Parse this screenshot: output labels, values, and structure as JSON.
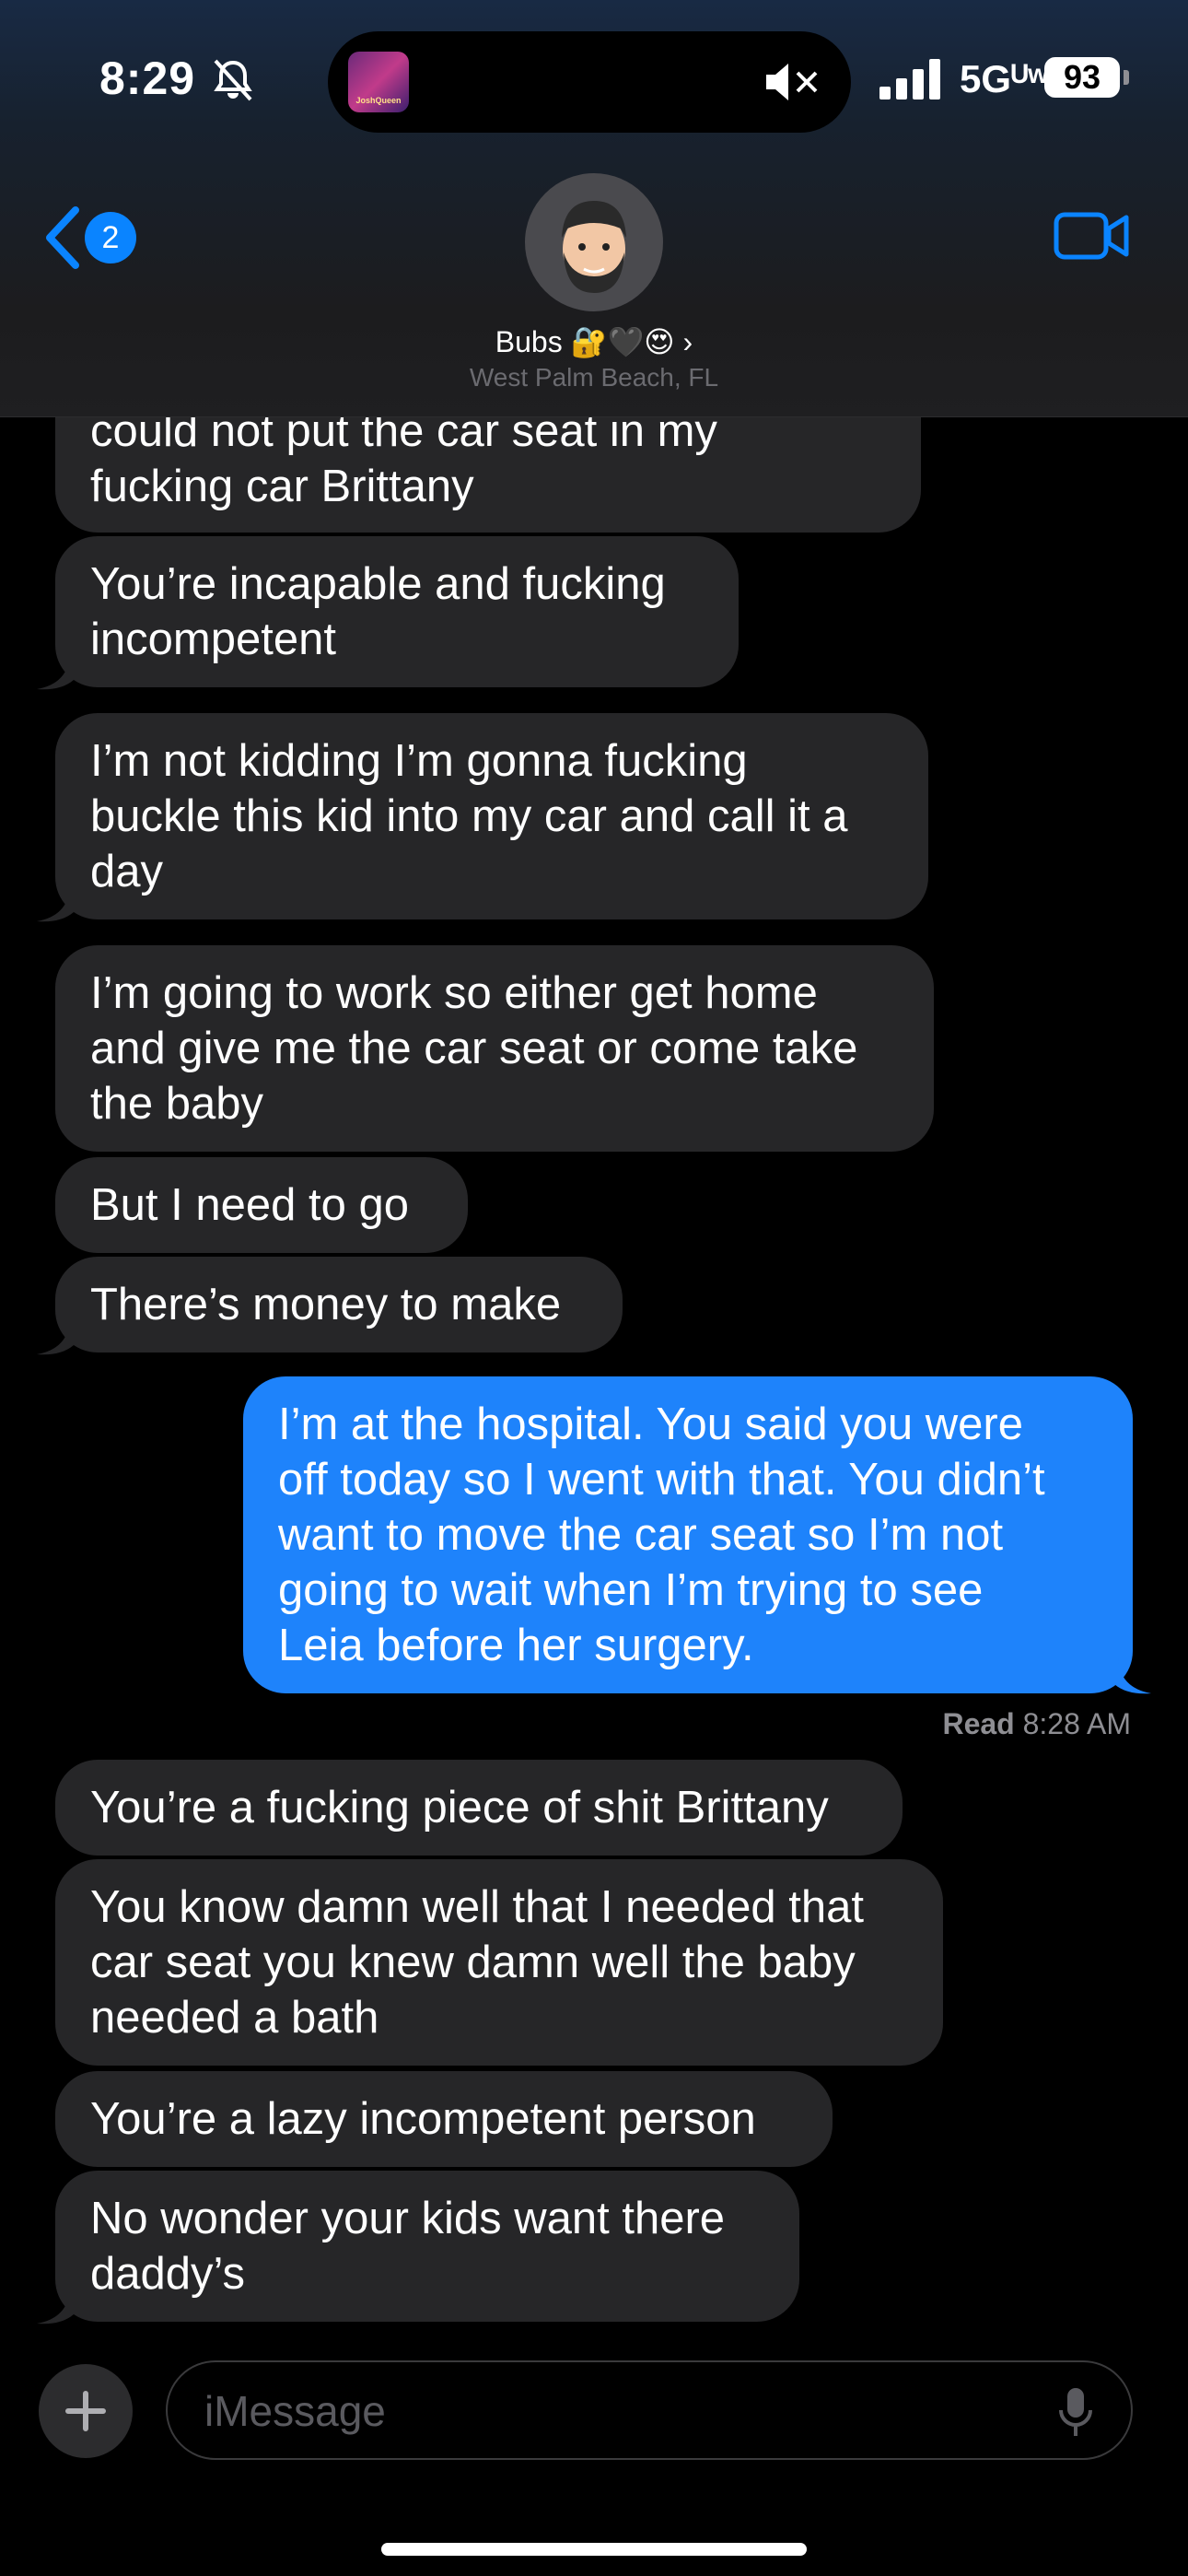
{
  "status_bar": {
    "time": "8:29",
    "network": "5Gᵁʷ",
    "battery": "93",
    "island_thumb_text": "JoshQueen"
  },
  "header": {
    "back_count": "2",
    "contact_name": "Bubs 🔐🖤😍 ›",
    "contact_location": "West Palm Beach, FL"
  },
  "messages": [
    {
      "from": "them",
      "text": "could not put the car seat in my\nfucking car Brittany"
    },
    {
      "from": "them",
      "text": "You’re incapable and fucking\nincompetent"
    },
    {
      "from": "them",
      "text": "I’m not kidding I’m gonna fucking\nbuckle this kid into my car and call it a\nday"
    },
    {
      "from": "them",
      "text": "I’m going to work so either get home\nand give me the car seat or come take\nthe baby"
    },
    {
      "from": "them",
      "text": "But I need to go"
    },
    {
      "from": "them",
      "text": "There’s money to make"
    },
    {
      "from": "me",
      "text": "I’m at the hospital. You said you were\noff today so I went with that. You didn’t\nwant to move the car seat so I’m not\ngoing to wait when I’m trying to see\nLeia before her surgery."
    },
    {
      "from": "them",
      "text": "You’re a fucking piece of shit Brittany"
    },
    {
      "from": "them",
      "text": "You know damn well that I needed that\ncar seat you knew damn well the baby\nneeded a bath"
    },
    {
      "from": "them",
      "text": "You’re a lazy incompetent person"
    },
    {
      "from": "them",
      "text": "No wonder your kids want there\ndaddy’s"
    }
  ],
  "read_receipt": {
    "label": "Read",
    "time": "8:28 AM"
  },
  "composer": {
    "placeholder": "iMessage"
  },
  "colors": {
    "incoming": "#262628",
    "outgoing": "#1e83fb",
    "accent": "#0a84ff"
  },
  "icons": [
    "bell-slash-icon",
    "speaker-mute-icon",
    "signal-icon",
    "back-chevron-icon",
    "video-camera-icon",
    "plus-icon",
    "microphone-icon"
  ]
}
